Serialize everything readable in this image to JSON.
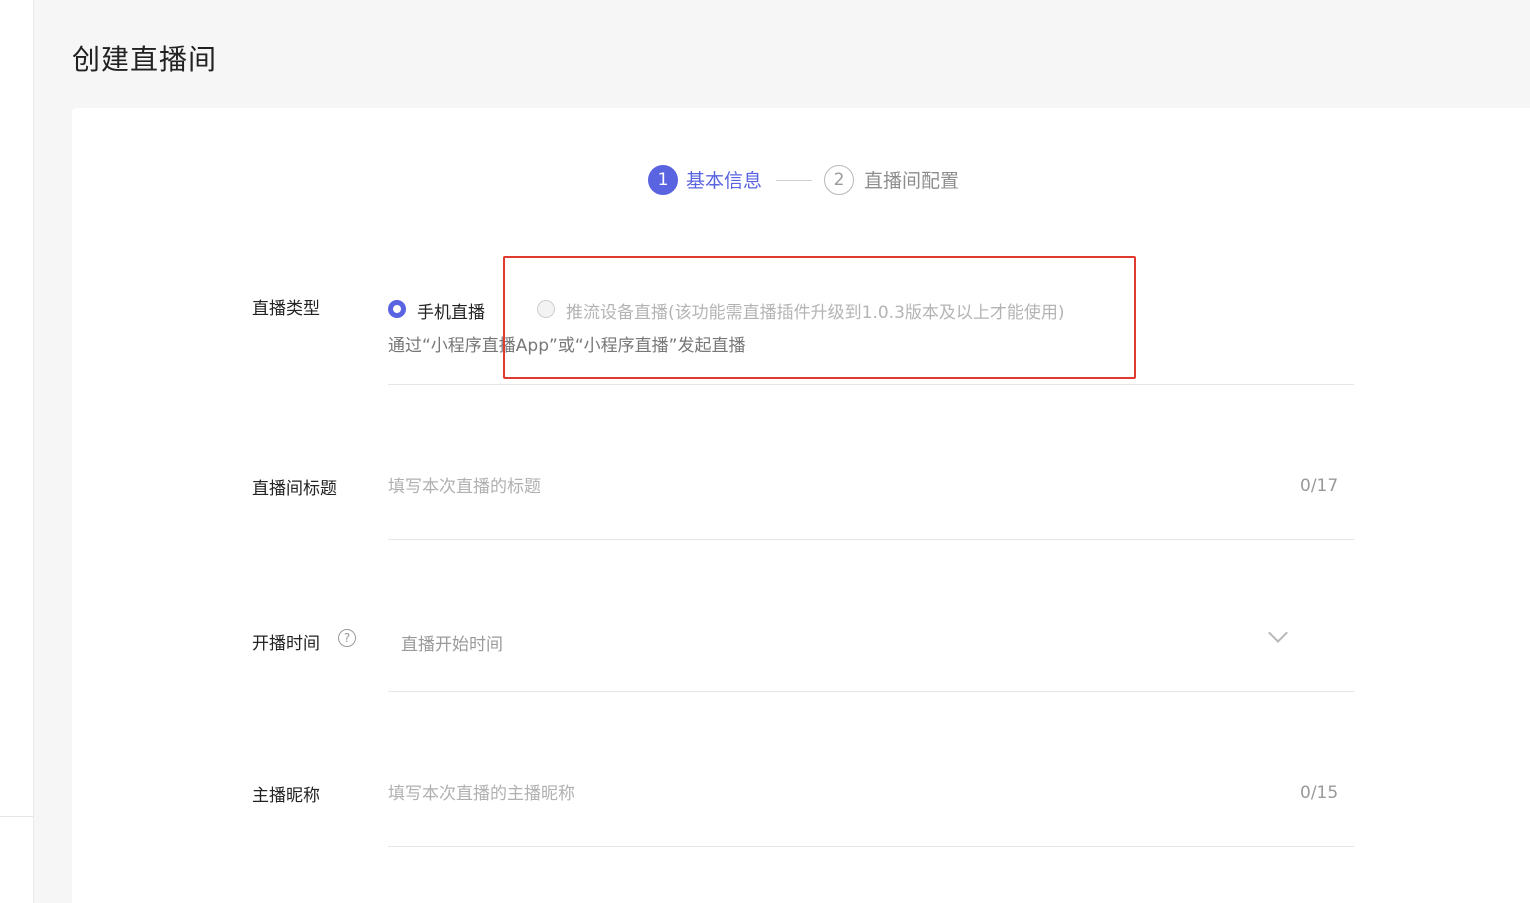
{
  "page": {
    "title": "创建直播间"
  },
  "steps": [
    {
      "number": "1",
      "label": "基本信息"
    },
    {
      "number": "2",
      "label": "直播间配置"
    }
  ],
  "form": {
    "live_type": {
      "label": "直播类型",
      "options": [
        {
          "label": "手机直播",
          "selected": true
        },
        {
          "label": "推流设备直播(该功能需直播插件升级到1.0.3版本及以上才能使用)",
          "selected": false,
          "disabled": true
        }
      ],
      "hint": "通过“小程序直播App”或“小程序直播”发起直播"
    },
    "room_title": {
      "label": "直播间标题",
      "placeholder": "填写本次直播的标题",
      "value": "",
      "counter": "0/17"
    },
    "start_time": {
      "label": "开播时间",
      "help_icon": "?",
      "placeholder": "直播开始时间"
    },
    "host_nickname": {
      "label": "主播昵称",
      "placeholder": "填写本次直播的主播昵称",
      "value": "",
      "counter": "0/15"
    }
  },
  "colors": {
    "accent": "#5a63e0",
    "highlight_border": "#e03a2f"
  }
}
